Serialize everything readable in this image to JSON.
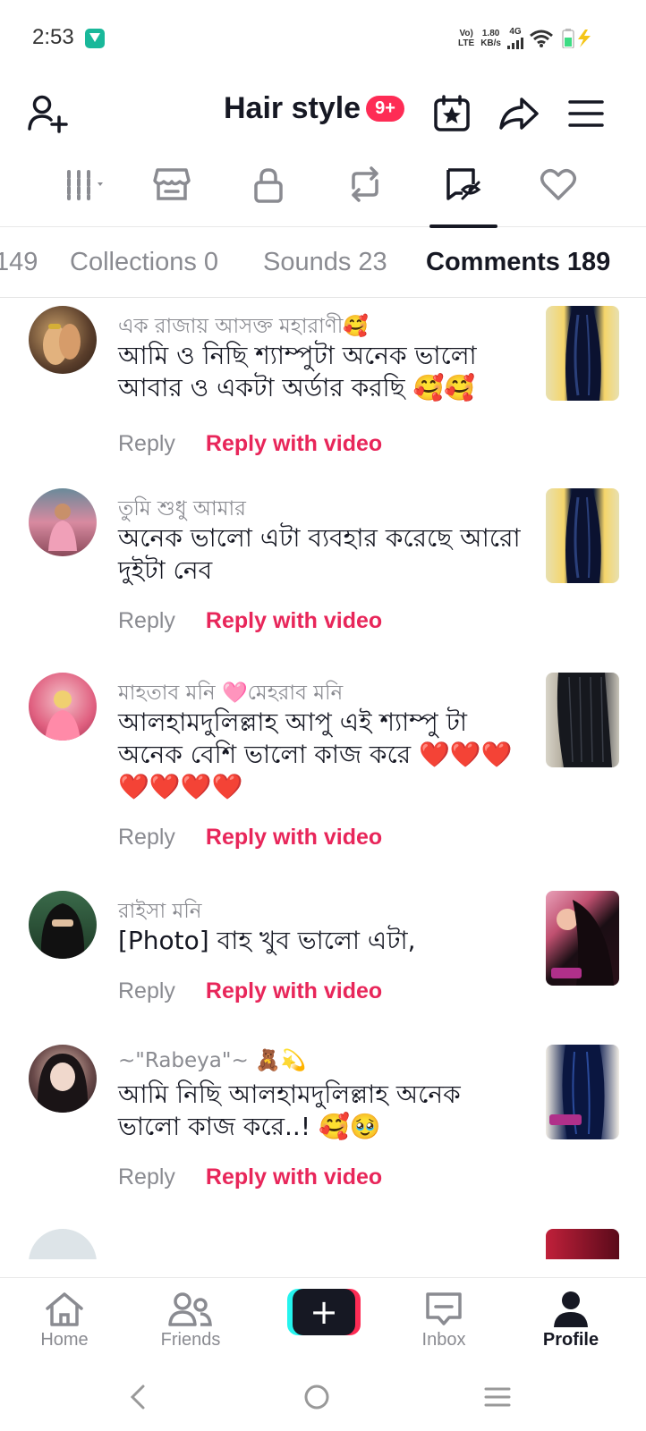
{
  "status_bar": {
    "time": "2:53",
    "volte": "Vo)",
    "lte": "LTE",
    "speed_value": "1.80",
    "speed_unit": "KB/s",
    "network": "4G"
  },
  "header": {
    "title": "Hair style",
    "badge": "9+"
  },
  "icon_tabs": [
    {
      "name": "videos-grid",
      "active": false
    },
    {
      "name": "shop",
      "active": false
    },
    {
      "name": "private",
      "active": false
    },
    {
      "name": "reposts",
      "active": false
    },
    {
      "name": "comments",
      "active": true
    },
    {
      "name": "liked",
      "active": false
    }
  ],
  "text_tabs": {
    "partial": "149",
    "collections": "Collections 0",
    "sounds": "Sounds 23",
    "comments": "Comments 189"
  },
  "actions": {
    "reply": "Reply",
    "reply_video": "Reply with video"
  },
  "comments": [
    {
      "username": "এক রাজায় আসক্ত মহারাণী🥰",
      "text": "আমি ও নিছি শ্যাম্পুটা অনেক ভালো আবার ও একটা অর্ডার করছি 🥰🥰"
    },
    {
      "username": "তুমি শুধু আমার",
      "text": "অনেক ভালো এটা ব্যবহার করেছে আরো দুইটা নেব"
    },
    {
      "username": "মাহতাব মনি 🩷মেহরাব মনি",
      "text": "আলহামদুলিল্লাহ আপু এই শ্যাম্পু টা অনেক বেশি ভালো কাজ করে ❤️❤️❤️❤️❤️❤️❤️"
    },
    {
      "username": "রাইসা মনি",
      "text": "[Photo] বাহ খুব ভালো এটা,"
    },
    {
      "username": "~\"Rabeya\"~ 🧸💫",
      "text": "আমি নিছি আলহামদুলিল্লাহ অনেক ভালো কাজ করে..! 🥰🥹"
    }
  ],
  "bottom_nav": {
    "home": "Home",
    "friends": "Friends",
    "create": "+",
    "inbox": "Inbox",
    "profile": "Profile"
  },
  "colors": {
    "accent_red": "#fe2c55",
    "reply_video_pink": "#e8265a",
    "cyan": "#25f4ee",
    "text_dark": "#161823",
    "text_gray": "#8a8b91"
  }
}
